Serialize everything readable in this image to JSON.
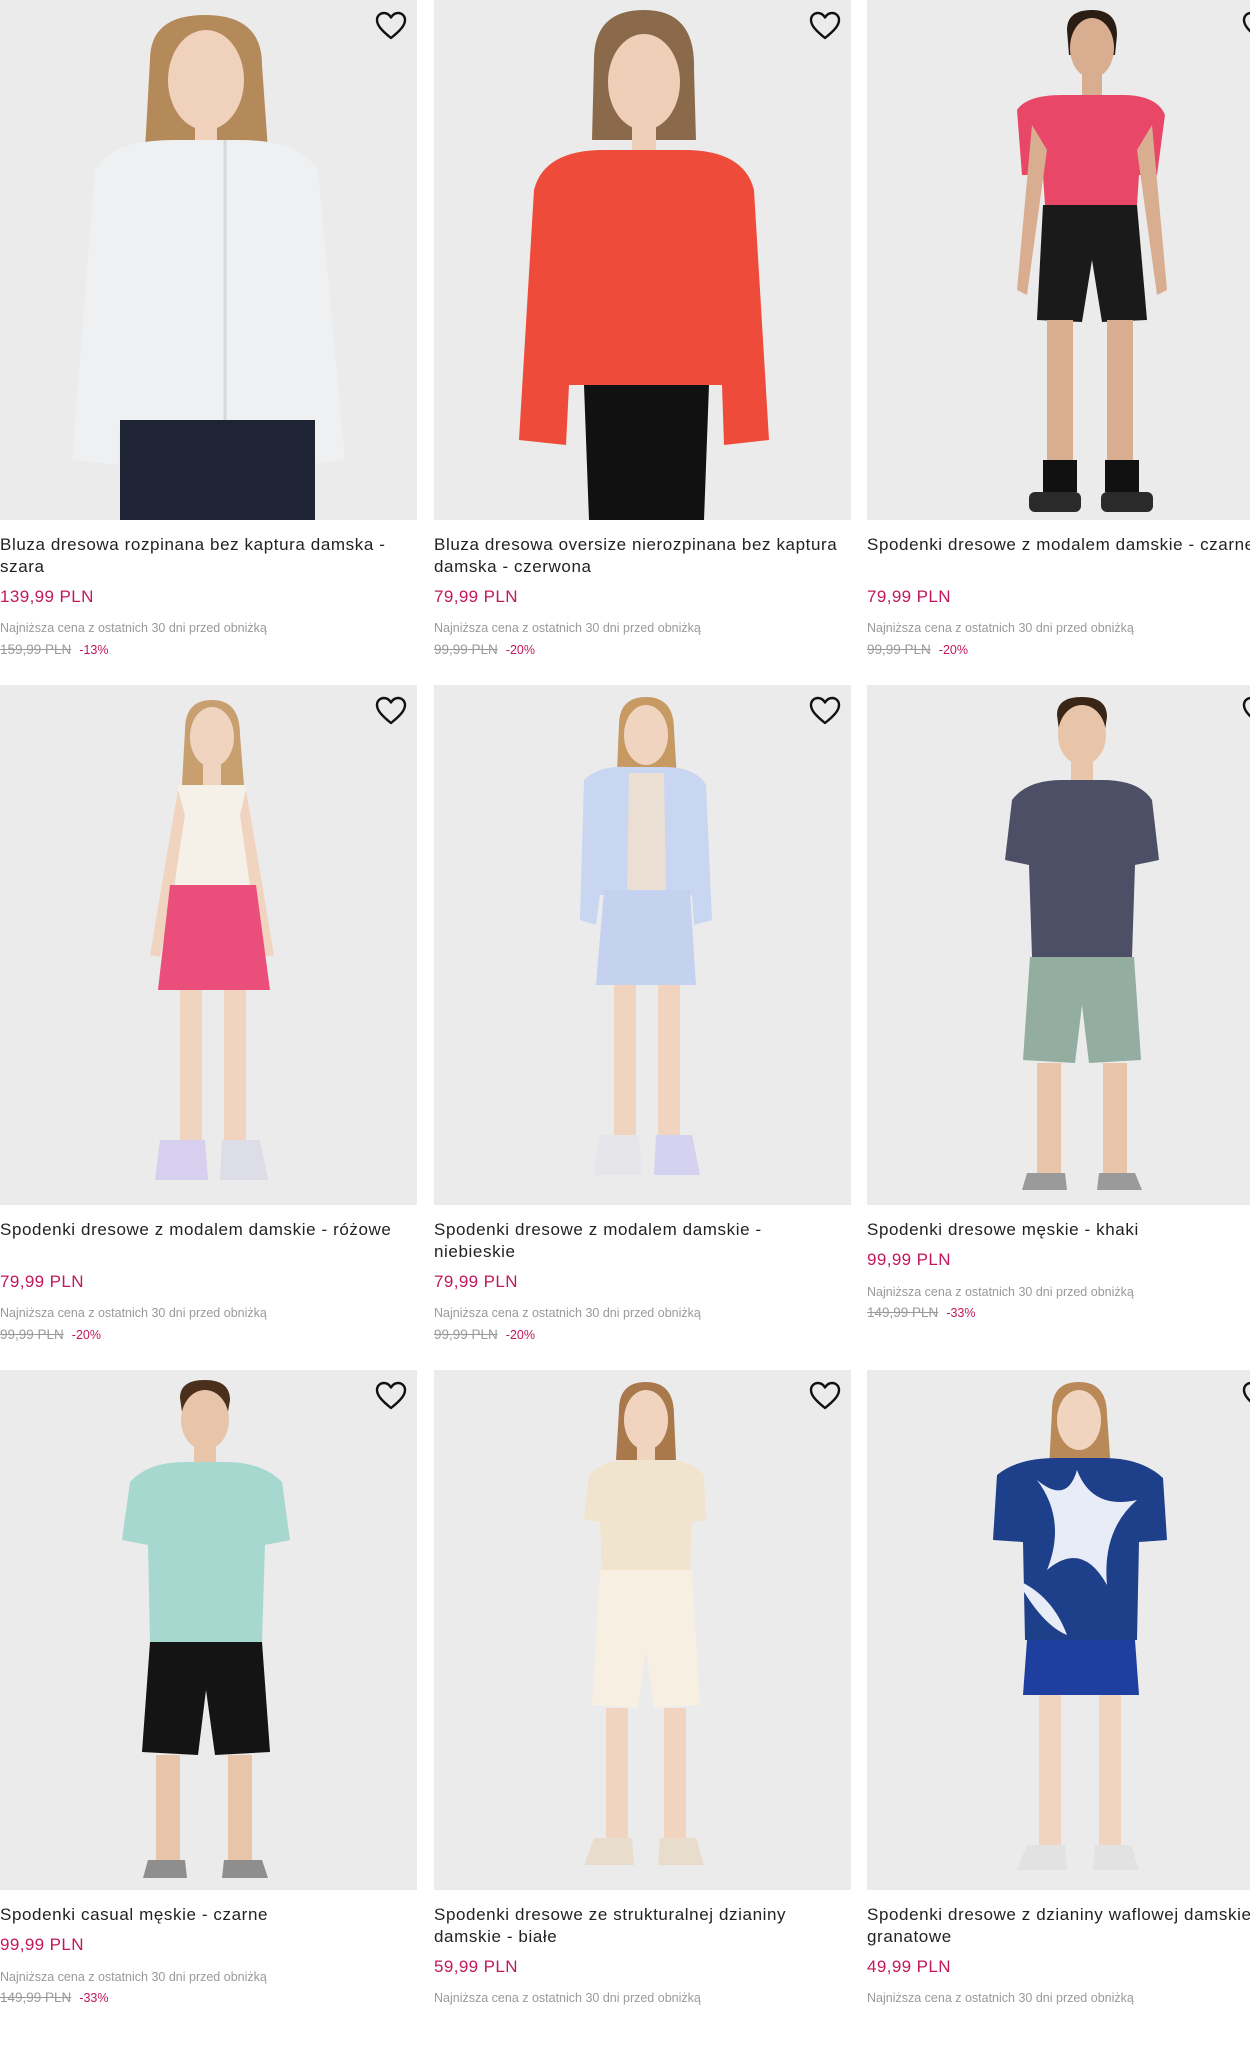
{
  "products": [
    {
      "name": "Bluza dresowa rozpinana bez kaptura damska - szara",
      "price": "139,99 PLN",
      "lowest_label": "Najniższa cena z ostatnich 30 dni przed obniżką",
      "old_price": "159,99 PLN",
      "discount": "-13%"
    },
    {
      "name": "Bluza dresowa oversize nierozpinana bez kaptura damska - czerwona",
      "price": "79,99 PLN",
      "lowest_label": "Najniższa cena z ostatnich 30 dni przed obniżką",
      "old_price": "99,99 PLN",
      "discount": "-20%"
    },
    {
      "name": "Spodenki dresowe z modalem damskie - czarne",
      "price": "79,99 PLN",
      "lowest_label": "Najniższa cena z ostatnich 30 dni przed obniżką",
      "old_price": "99,99 PLN",
      "discount": "-20%"
    },
    {
      "name": "Spodenki dresowe z modalem damskie - różowe",
      "price": "79,99 PLN",
      "lowest_label": "Najniższa cena z ostatnich 30 dni przed obniżką",
      "old_price": "99,99 PLN",
      "discount": "-20%"
    },
    {
      "name": "Spodenki dresowe z modalem damskie - niebieskie",
      "price": "79,99 PLN",
      "lowest_label": "Najniższa cena z ostatnich 30 dni przed obniżką",
      "old_price": "99,99 PLN",
      "discount": "-20%"
    },
    {
      "name": "Spodenki dresowe męskie - khaki",
      "price": "99,99 PLN",
      "lowest_label": "Najniższa cena z ostatnich 30 dni przed obniżką",
      "old_price": "149,99 PLN",
      "discount": "-33%"
    },
    {
      "name": "Spodenki casual męskie - czarne",
      "price": "99,99 PLN",
      "lowest_label": "Najniższa cena z ostatnich 30 dni przed obniżką",
      "old_price": "149,99 PLN",
      "discount": "-33%"
    },
    {
      "name": "Spodenki dresowe ze strukturalnej dzianiny damskie - białe",
      "price": "59,99 PLN",
      "lowest_label": "Najniższa cena z ostatnich 30 dni przed obniżką",
      "old_price": "",
      "discount": ""
    },
    {
      "name": "Spodenki dresowe z dzianiny waflowej damskie - granatowe",
      "price": "49,99 PLN",
      "lowest_label": "Najniższa cena z ostatnich 30 dni przed obniżką",
      "old_price": "",
      "discount": ""
    }
  ],
  "icons": {
    "favorite": "heart-outline-icon"
  },
  "colors": {
    "price": "#c2185b",
    "muted": "#9a9a9a",
    "image_bg": "#ebebeb"
  }
}
